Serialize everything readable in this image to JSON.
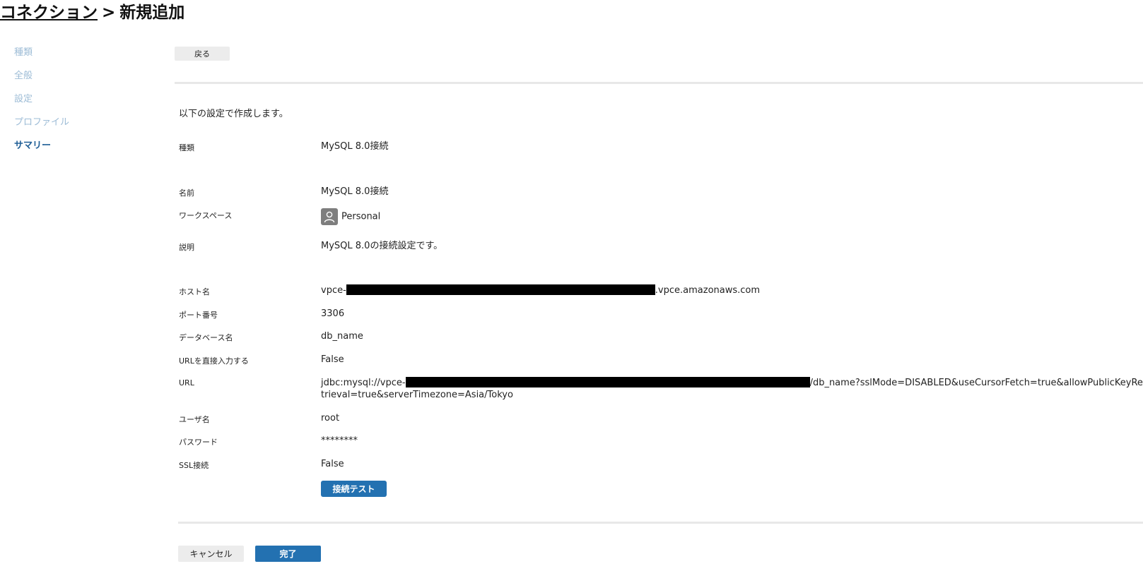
{
  "header": {
    "breadcrumb_link": "コネクション",
    "separator": ">",
    "current": "新規追加"
  },
  "sidebar": {
    "steps": [
      {
        "label": "種類",
        "active": false
      },
      {
        "label": "全般",
        "active": false
      },
      {
        "label": "設定",
        "active": false
      },
      {
        "label": "プロファイル",
        "active": false
      },
      {
        "label": "サマリー",
        "active": true
      }
    ]
  },
  "toolbar": {
    "back_label": "戻る"
  },
  "summary": {
    "intro": "以下の設定で作成します。",
    "type_label": "種類",
    "type_value": "MySQL 8.0接続",
    "name_label": "名前",
    "name_value": "MySQL 8.0接続",
    "workspace_label": "ワークスペース",
    "workspace_value": "Personal",
    "workspace_icon": "user-icon",
    "description_label": "説明",
    "description_value": "MySQL 8.0の接続設定です。",
    "host_label": "ホスト名",
    "host_prefix": "vpce-",
    "host_suffix": ".vpce.amazonaws.com",
    "port_label": "ポート番号",
    "port_value": "3306",
    "database_label": "データベース名",
    "database_value": "db_name",
    "url_direct_label": "URLを直接入力する",
    "url_direct_value": "False",
    "url_label": "URL",
    "url_prefix": "jdbc:mysql://vpce-",
    "url_suffix": "/db_name?sslMode=DISABLED&useCursorFetch=true&allowPublicKeyRetrieval=true&serverTimezone=Asia/Tokyo",
    "user_label": "ユーザ名",
    "user_value": "root",
    "password_label": "パスワード",
    "password_value": "********",
    "ssl_label": "SSL接続",
    "ssl_value": "False",
    "test_button": "接続テスト"
  },
  "footer": {
    "cancel_label": "キャンセル",
    "finish_label": "完了"
  },
  "colors": {
    "primary": "#2371b1",
    "sidebar_inactive": "#9dbcd6",
    "sidebar_active": "#1f5e96",
    "redaction": "#000000"
  }
}
